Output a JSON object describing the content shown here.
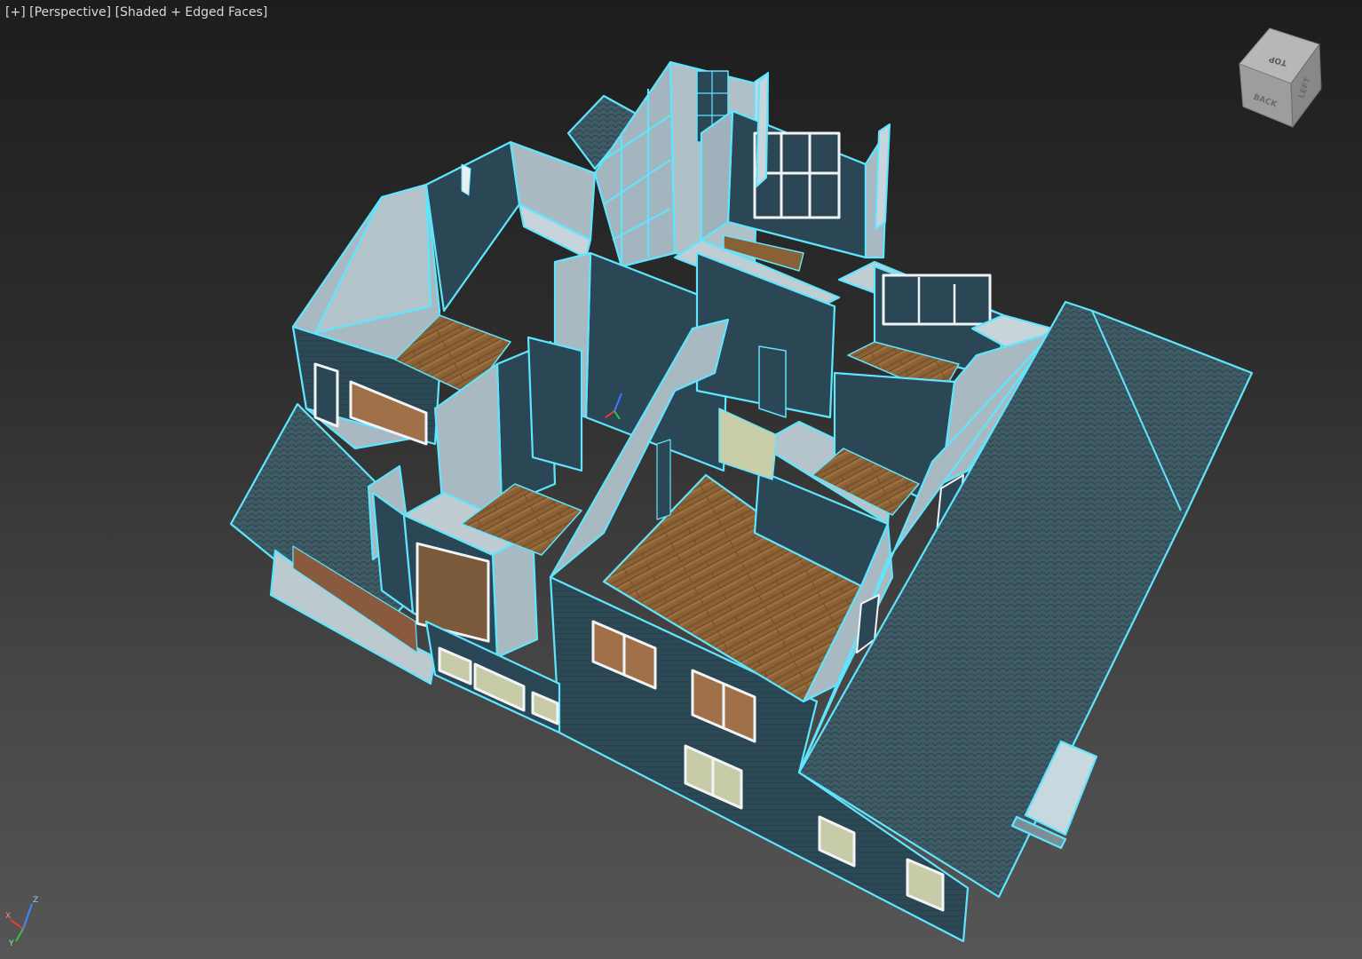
{
  "viewport": {
    "menu_plus": "[+]",
    "view_mode": "[Perspective]",
    "shading_mode": "[Shaded + Edged Faces]"
  },
  "viewcube": {
    "top_label": "TOP",
    "back_label": "BACK",
    "side_label": "LEFT"
  },
  "axis_gizmo": {
    "z_label": "Z",
    "y_label": "Y",
    "x_label": "X"
  },
  "colors": {
    "selection_outline": "#5fe6ff",
    "wall_dark": "#2c4654",
    "wall_light": "#a9bbc3",
    "roof": "#3d5a63",
    "floor_wood": "#8a6136",
    "window_frame": "#f1f1f1"
  }
}
